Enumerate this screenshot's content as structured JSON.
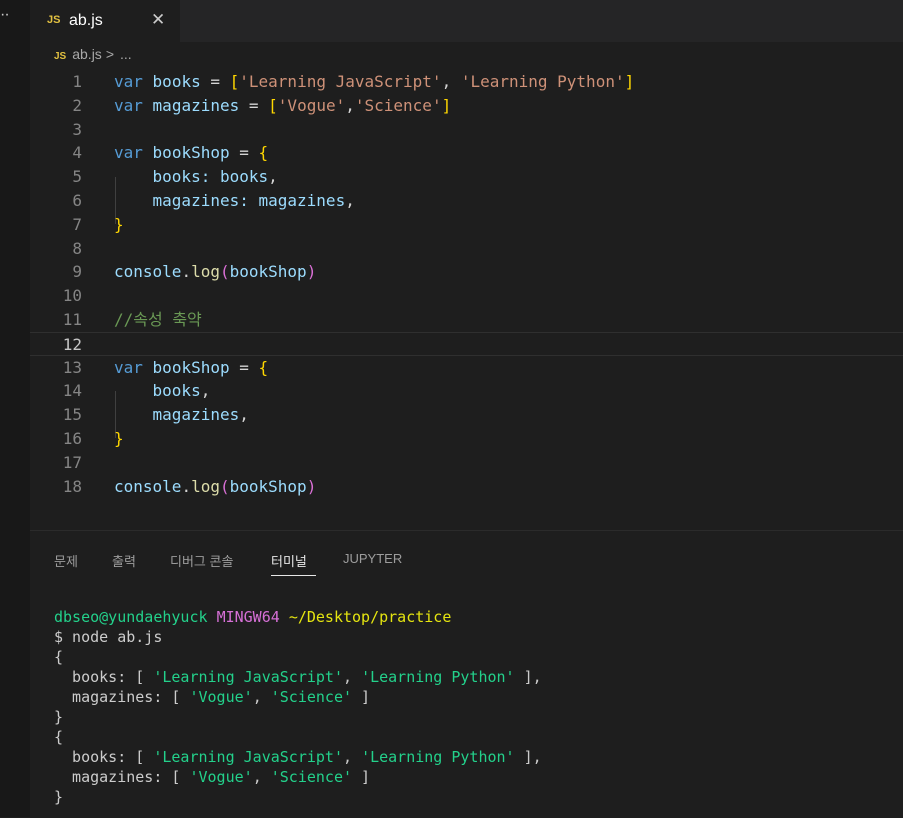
{
  "sidebar": {
    "more_label": "··"
  },
  "tab": {
    "badge": "JS",
    "filename": "ab.js",
    "close_glyph": "✕"
  },
  "breadcrumb": {
    "badge": "JS",
    "file": "ab.js",
    "sep": ">",
    "rest": "..."
  },
  "editor": {
    "current_line": 12,
    "lines": [
      {
        "n": "1"
      },
      {
        "n": "2"
      },
      {
        "n": "3"
      },
      {
        "n": "4"
      },
      {
        "n": "5"
      },
      {
        "n": "6"
      },
      {
        "n": "7"
      },
      {
        "n": "8"
      },
      {
        "n": "9"
      },
      {
        "n": "10"
      },
      {
        "n": "11"
      },
      {
        "n": "12"
      },
      {
        "n": "13"
      },
      {
        "n": "14"
      },
      {
        "n": "15"
      },
      {
        "n": "16"
      },
      {
        "n": "17"
      },
      {
        "n": "18"
      }
    ],
    "tokens": {
      "var": "var",
      "books_id": "books",
      "magazines_id": "magazines",
      "eq": " = ",
      "lb": "[",
      "rb": "]",
      "s_learn_js": "'Learning JavaScript'",
      "s_learn_py": "'Learning Python'",
      "s_vogue": "'Vogue'",
      "s_science": "'Science'",
      "comma_sp": ", ",
      "comma": ",",
      "bookShop_id": "bookShop",
      "lbrace": "{",
      "rbrace": "}",
      "books_prop": "books:",
      "magazines_prop": "magazines:",
      "console": "console",
      "dot": ".",
      "log": "log",
      "lp": "(",
      "rp": ")",
      "comment": "//속성 축약"
    }
  },
  "panel": {
    "tabs": [
      "문제",
      "출력",
      "디버그 콘솔",
      "터미널",
      "JUPYTER"
    ],
    "active_tab": "터미널"
  },
  "terminal": {
    "user_host": "dbseo@yundaehyuck",
    "shell": "MINGW64",
    "path": "~/Desktop/practice",
    "command": "$ node ab.js",
    "open_brace": "{",
    "close_brace": "}",
    "books_key": "  books: [ ",
    "magazines_key": "  magazines: [ ",
    "s_learn_js": "'Learning JavaScript'",
    "s_learn_py": "'Learning Python'",
    "s_vogue": "'Vogue'",
    "s_science": "'Science'",
    "comma_sp": ", ",
    "arr_end_comma": " ],",
    "arr_end": " ]"
  },
  "colors": {
    "background": "#1e1e1e",
    "keyword": "#569cd6",
    "variable": "#9cdcfe",
    "string": "#ce9178",
    "comment": "#6a9955",
    "terminal_green": "#23d18b"
  }
}
